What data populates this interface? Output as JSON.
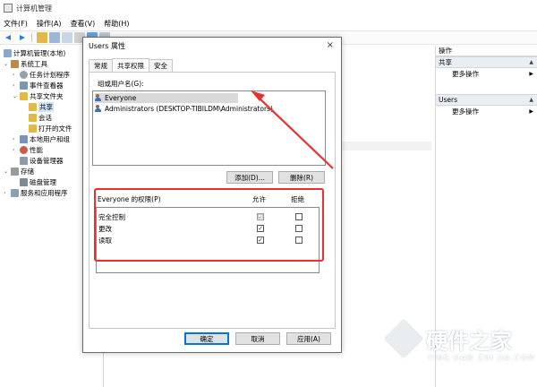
{
  "window": {
    "title": "计算机管理"
  },
  "menubar": {
    "file": "文件(F)",
    "action": "操作(A)",
    "view": "查看(V)",
    "help": "帮助(H)"
  },
  "tree": {
    "root": "计算机管理(本地)",
    "system_tools": "系统工具",
    "task_scheduler": "任务计划程序",
    "event_viewer": "事件查看器",
    "shared_folders": "共享文件夹",
    "shares": "共享",
    "sessions": "会话",
    "open_files": "打开的文件",
    "local_users": "本地用户和组",
    "performance": "性能",
    "device_manager": "设备管理器",
    "storage": "存储",
    "disk_management": "磁盘管理",
    "services": "服务和应用程序"
  },
  "actions": {
    "header": "操作",
    "section1": "共享",
    "section1_more": "更多操作",
    "section2": "Users",
    "section2_more": "更多操作"
  },
  "dialog": {
    "title": "Users 属性",
    "close": "×",
    "tabs": [
      "常规",
      "共享权限",
      "安全"
    ],
    "group_label": "组或用户名(G):",
    "users": [
      "Everyone",
      "Administrators (DESKTOP-TIBILDM\\Administrators)"
    ],
    "add_button": "添加(D)...",
    "remove_button": "删除(R)",
    "perm_label": "Everyone 的权限(P)",
    "allow_header": "允许",
    "deny_header": "拒绝",
    "permissions": [
      {
        "name": "完全控制",
        "allow": "☑",
        "deny": ""
      },
      {
        "name": "更改",
        "allow": "✓",
        "deny": ""
      },
      {
        "name": "读取",
        "allow": "✓",
        "deny": ""
      }
    ],
    "ok_button": "确定",
    "cancel_button": "取消",
    "apply_button": "应用(A)"
  },
  "watermark": {
    "title": "硬件之家",
    "subtitle": "YING JIAN ZHI JIA.COM"
  },
  "colors": {
    "annotation": "#e8302f",
    "selection": "#cde6f7",
    "accent": "#0078d7"
  }
}
